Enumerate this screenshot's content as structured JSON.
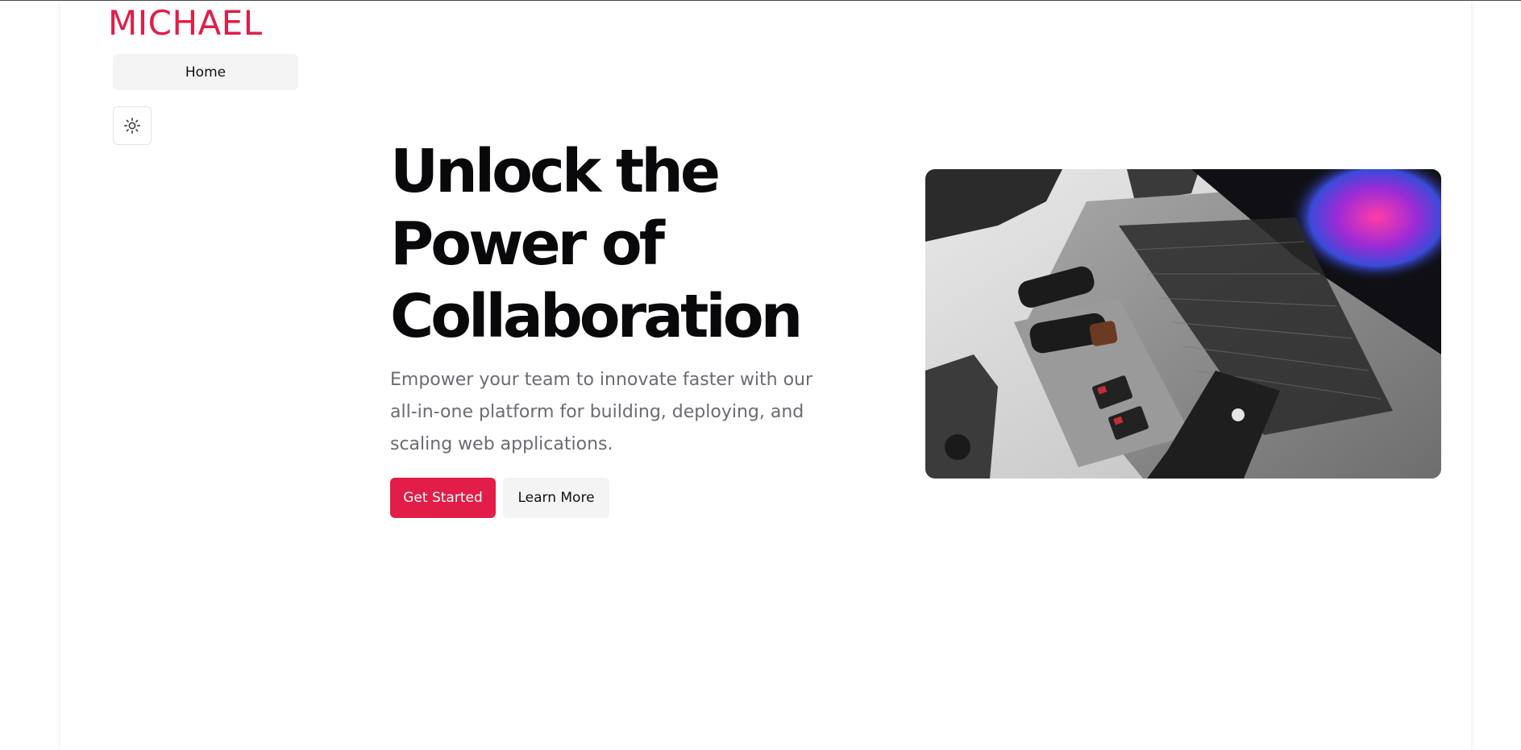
{
  "brand": {
    "name": "MICHAEL"
  },
  "nav": {
    "home_label": "Home"
  },
  "theme_toggle": {
    "icon": "sun-icon"
  },
  "hero": {
    "title_lines": [
      "Unlock the",
      "Power of",
      "Collaboration"
    ],
    "subtitle": "Empower your team to innovate faster with our all-in-one platform for building, deploying, and scaling web applications.",
    "primary_cta": "Get Started",
    "secondary_cta": "Learn More",
    "image": {
      "description_icon": "laptop-photo"
    }
  },
  "colors": {
    "accent": "#e11d48",
    "heading": "#09090b",
    "muted_text": "#6b6b73",
    "secondary_bg": "#f4f4f5"
  }
}
